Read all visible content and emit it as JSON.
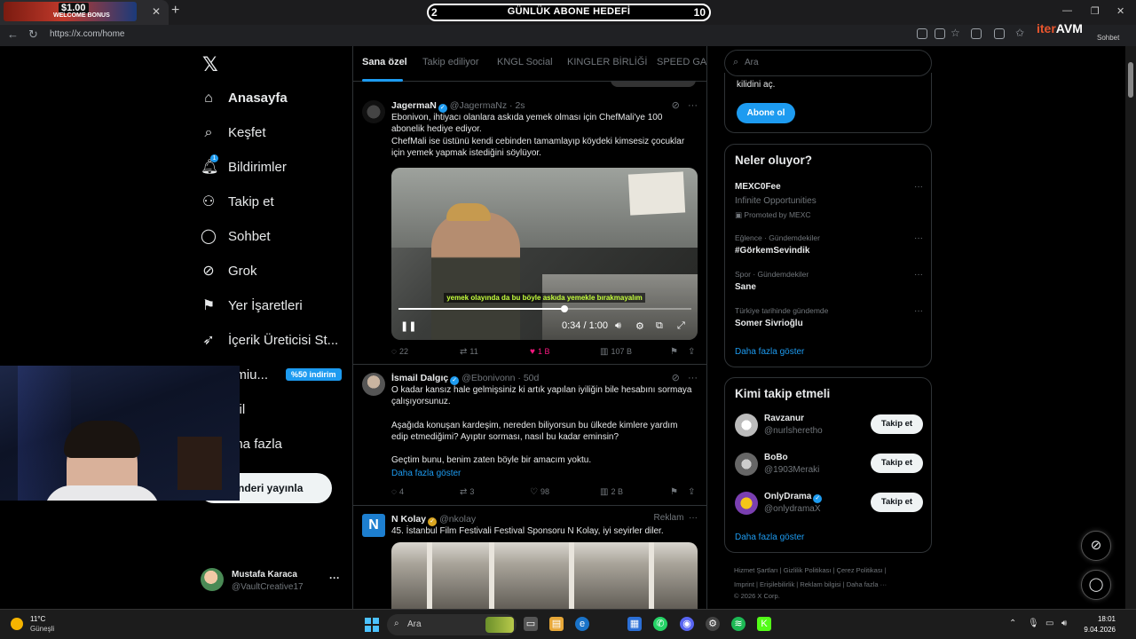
{
  "browser": {
    "tab_promo_amount": "$1.00",
    "tab_promo_text": "WELCOME BONUS",
    "url": "https://x.com/home",
    "goal_left": "2",
    "goal_title": "GÜNLÜK ABONE HEDEFİ",
    "goal_right": "10",
    "overlay_logo_a": "iter",
    "overlay_logo_b": "AVM",
    "top_right_label": "Sohbet"
  },
  "nav": {
    "items": [
      {
        "label": "Anasayfa",
        "icon": "home-icon"
      },
      {
        "label": "Keşfet",
        "icon": "search-icon"
      },
      {
        "label": "Bildirimler",
        "icon": "bell-icon"
      },
      {
        "label": "Takip et",
        "icon": "add-person-icon"
      },
      {
        "label": "Sohbet",
        "icon": "chat-icon"
      },
      {
        "label": "Grok",
        "icon": "grok-icon"
      },
      {
        "label": "Yer İşaretleri",
        "icon": "bookmark-icon"
      },
      {
        "label": "İçerik Üreticisi St...",
        "icon": "rocket-icon"
      },
      {
        "label": "emiu...",
        "icon": "premium-icon"
      },
      {
        "label": "ofil",
        "icon": "profile-icon"
      },
      {
        "label": "aha fazla",
        "icon": "more-icon"
      }
    ],
    "notif_count": "1",
    "premium_badge": "%50 indirim",
    "post_button": "nderi yayınla",
    "account_name": "Mustafa Karaca",
    "account_handle": "@VaultCreative17",
    "account_more": "···"
  },
  "feed": {
    "tabs": [
      "Sana özel",
      "Takip ediliyor",
      "KNGL Social",
      "KINGLER BİRLİĞİ",
      "SPEED GAN"
    ],
    "tweets": [
      {
        "name": "JagermaN",
        "handle": "@JagermaNz · 2s",
        "text1": "Ebonivon, ihtiyacı olanlara askıda yemek olması için ChefMali'ye 100",
        "text2": "abonelik hediye ediyor.",
        "text3": "ChefMali ise üstünü kendi cebinden tamamlayıp köydeki kimsesiz çocuklar",
        "text4": "için yemek yapmak istediğini söylüyor.",
        "video_subtitle": "yemek olayında da bu böyle askıda yemekle bırakmayalım",
        "video_time": "0:34 / 1:00",
        "video_progress": 0.567,
        "replies": "22",
        "reposts": "11",
        "likes": "1 B",
        "views": "107 B"
      },
      {
        "name": "İsmail Dalgıç",
        "handle": "@Ebonivonn · 50d",
        "text1": "O kadar kansız hale gelmişsiniz ki artık yapılan iyiliğin bile hesabını sormaya",
        "text2": "çalışıyorsunuz.",
        "text3": "Aşağıda konuşan kardeşim, nereden biliyorsun bu ülkede kimlere yardım",
        "text4": "edip etmediğimi? Ayıptır sorması, nasıl bu kadar eminsin?",
        "text5": "Geçtim bunu, benim zaten böyle bir amacım yoktu.",
        "more": "Daha fazla göster",
        "replies": "4",
        "reposts": "3",
        "likes": "98",
        "views": "2 B"
      },
      {
        "name": "N Kolay",
        "handle": "@nkolay",
        "ad_label": "Reklam",
        "text1": "45. İstanbul Film Festivali Festival Sponsoru N Kolay, iyi seyirler diler."
      }
    ]
  },
  "right": {
    "search_placeholder": "Ara",
    "premium_unlock": "kilidini aç.",
    "subscribe": "Abone ol",
    "trends_title": "Neler oluyor?",
    "trends": [
      {
        "meta": "",
        "name": "MEXC0Fee",
        "sub": "Infinite Opportunities",
        "promo": "Promoted by MEXC"
      },
      {
        "meta": "Eğlence · Gündemdekiler",
        "name": "#GörkemSevindik"
      },
      {
        "meta": "Spor · Gündemdekiler",
        "name": "Sane"
      },
      {
        "meta": "Türkiye tarihinde gündemde",
        "name": "Somer Sivrioğlu"
      }
    ],
    "trends_more": "Daha fazla göster",
    "follow_title": "Kimi takip etmeli",
    "follow": [
      {
        "name": "Ravzanur",
        "handle": "@nurlsheretho",
        "button": "Takip et"
      },
      {
        "name": "BoBo",
        "handle": "@1903Meraki",
        "button": "Takip et"
      },
      {
        "name": "OnlyDrama",
        "handle": "@onlydramaX",
        "button": "Takip et"
      }
    ],
    "follow_more": "Daha fazla göster",
    "footer1": "Hizmet Şartları  |  Gizlilik Politikası  |  Çerez Politikası  |",
    "footer2": "Imprint  |  Erişilebilirlik  |  Reklam bilgisi  |  Daha fazla ···",
    "footer3": "© 2026 X Corp."
  },
  "taskbar": {
    "temp": "11°C",
    "weather": "Güneşli",
    "search": "Ara",
    "time": "18:01",
    "date": "9.04.2026"
  },
  "colors": {
    "accent": "#1d9bf0",
    "like": "#f91880",
    "bg": "#000000"
  }
}
